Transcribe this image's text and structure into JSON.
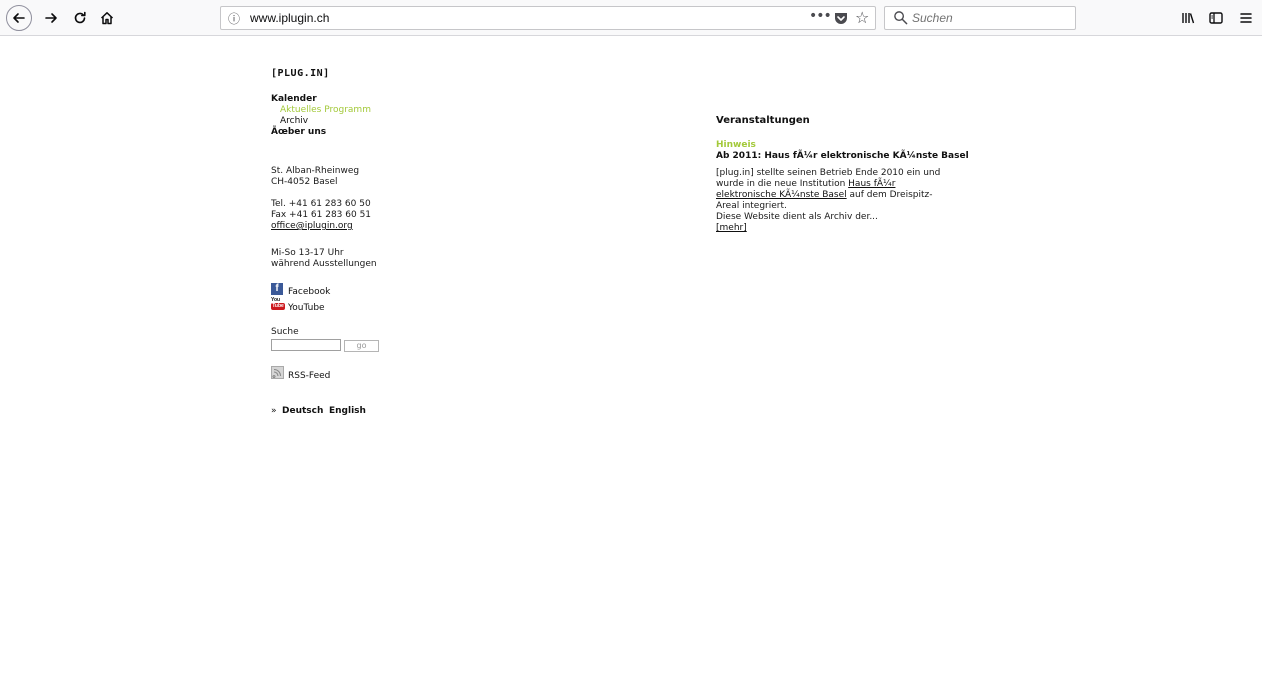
{
  "browser": {
    "url": "www.iplugin.ch",
    "search_placeholder": "Suchen",
    "more_label": "•••",
    "star_label": "☆",
    "info_label": "ⓘ"
  },
  "site": {
    "logo": "[PLUG.IN]",
    "nav": {
      "kalender": "Kalender",
      "aktuelles": "Aktuelles Programm",
      "archiv": "Archiv",
      "ueber": "Ãœber uns"
    },
    "address": {
      "line1": "St. Alban-Rheinweg",
      "line2": "CH-4052 Basel"
    },
    "contact": {
      "tel": "Tel. +41 61 283 60 50",
      "fax": "Fax +41 61 283 60 51",
      "email": "office@iplugin.org"
    },
    "hours": {
      "line1": "Mi-So 13-17 Uhr",
      "line2": "während Ausstellungen"
    },
    "social": {
      "facebook": "Facebook",
      "facebook_glyph": "f",
      "youtube": "YouTube",
      "yt_top": "You",
      "yt_bot": "Tube"
    },
    "search": {
      "label": "Suche",
      "button": "go"
    },
    "rss": "RSS-Feed",
    "lang": {
      "marker": "»",
      "de": "Deutsch",
      "en": "English"
    }
  },
  "main": {
    "title": "Veranstaltungen",
    "notice_label": "Hinweis",
    "news_title": "Ab 2011: Haus fÃ¼r elektronische KÃ¼nste Basel",
    "body": {
      "l1": "[plug.in] stellte seinen Betrieb Ende 2010 ein und",
      "l2a": "wurde in die neue Institution ",
      "l2_link": "Haus fÃ¼r",
      "l3_link": "elektronische KÃ¼nste Basel",
      "l3b": " auf dem Dreispitz-",
      "l4": "Areal integriert.",
      "l5": "Diese Website dient als Archiv der...",
      "more": "[mehr]"
    }
  }
}
